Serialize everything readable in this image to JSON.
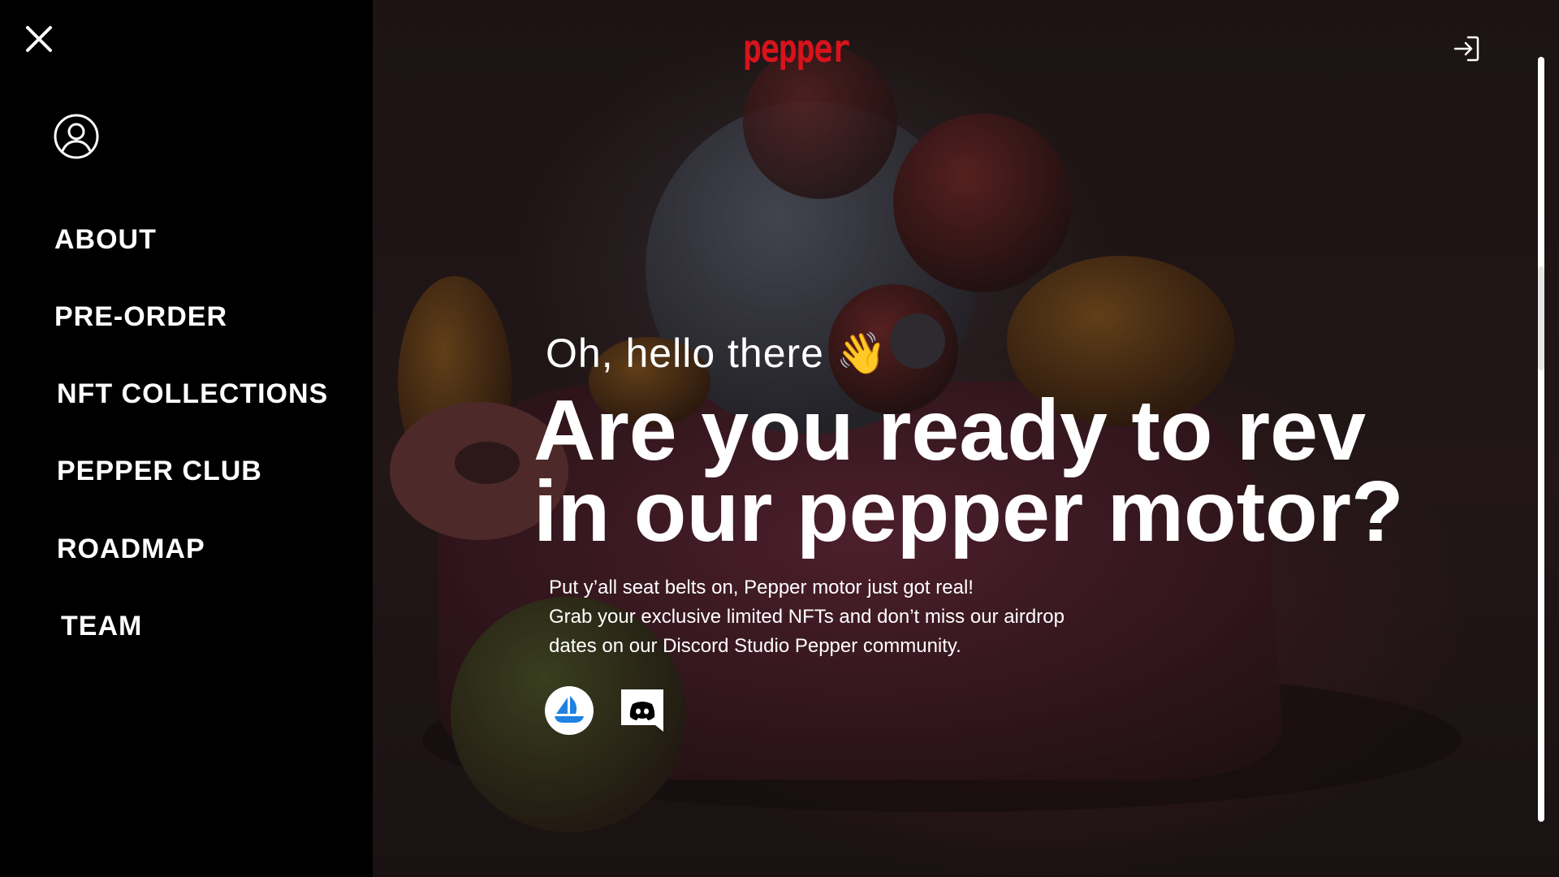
{
  "header": {
    "logo_text": "pepper",
    "logo_color": "#d8131c",
    "login_icon": "login-arrow-icon"
  },
  "drawer": {
    "close_icon": "close-icon",
    "account_icon": "user-circle-icon",
    "nav_items": [
      {
        "label": "ABOUT"
      },
      {
        "label": "PRE-ORDER"
      },
      {
        "label": "NFT COLLECTIONS"
      },
      {
        "label": "PEPPER CLUB"
      },
      {
        "label": "ROADMAP"
      },
      {
        "label": "TEAM"
      }
    ]
  },
  "hero": {
    "greeting": "Oh, hello there 👋",
    "headline_line1": "Are you ready to rev",
    "headline_line2": "in our pepper motor?",
    "subtext_lines": [
      "Put y’all seat belts on, Pepper motor just got real!",
      "Grab your exclusive limited NFTs and don’t miss our airdrop",
      "dates on our Discord Studio Pepper community."
    ],
    "social_links": [
      {
        "icon": "opensea-icon",
        "color": "#2081e2"
      },
      {
        "icon": "discord-icon",
        "color": "#000000"
      }
    ]
  },
  "colors": {
    "drawer_bg": "#000000",
    "text": "#ffffff",
    "accent": "#d8131c"
  }
}
